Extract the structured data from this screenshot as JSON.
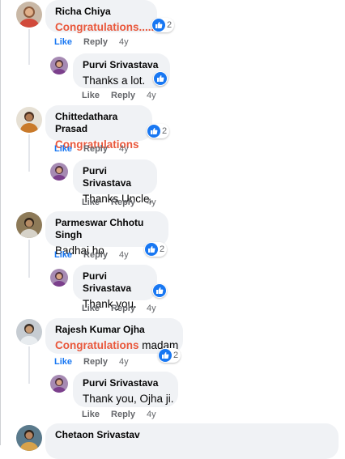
{
  "comments": [
    {
      "author": "Richa Chiya",
      "text_highlight": "Congratulations.....",
      "text_plain": "",
      "reaction_count": "2",
      "actions": {
        "like": "Like",
        "reply": "Reply",
        "time": "4y"
      },
      "reply": {
        "author": "Purvi Srivastava",
        "text": "Thanks a lot.",
        "actions": {
          "like": "Like",
          "reply": "Reply",
          "time": "4y"
        }
      }
    },
    {
      "author": "Chittedathara Prasad",
      "text_highlight": "Congratulations",
      "text_plain": "",
      "reaction_count": "2",
      "actions": {
        "like": "Like",
        "reply": "Reply",
        "time": "4y"
      },
      "reply": {
        "author": "Purvi Srivastava",
        "text": "Thanks Uncle.",
        "actions": {
          "like": "Like",
          "reply": "Reply",
          "time": "4y"
        }
      }
    },
    {
      "author": "Parmeswar Chhotu Singh",
      "text_highlight": "",
      "text_plain": "Badhai ho",
      "reaction_count": "2",
      "actions": {
        "like": "Like",
        "reply": "Reply",
        "time": "4y"
      },
      "reply": {
        "author": "Purvi Srivastava",
        "text": "Thank you.",
        "actions": {
          "like": "Like",
          "reply": "Reply",
          "time": "4y"
        }
      }
    },
    {
      "author": "Rajesh Kumar Ojha",
      "text_highlight": "Congratulations",
      "text_plain": " madam",
      "reaction_count": "2",
      "actions": {
        "like": "Like",
        "reply": "Reply",
        "time": "4y"
      },
      "reply": {
        "author": "Purvi Srivastava",
        "text": "Thank you, Ojha ji.",
        "actions": {
          "like": "Like",
          "reply": "Reply",
          "time": "4y"
        }
      }
    },
    {
      "author": "Chetaon Srivastav"
    }
  ],
  "colors": {
    "like_blue": "#1877f2",
    "highlight": "#e9573b",
    "bubble_bg": "#f0f2f5",
    "meta_gray": "#65676b"
  },
  "icons": {
    "reaction": "like-thumb-icon"
  }
}
